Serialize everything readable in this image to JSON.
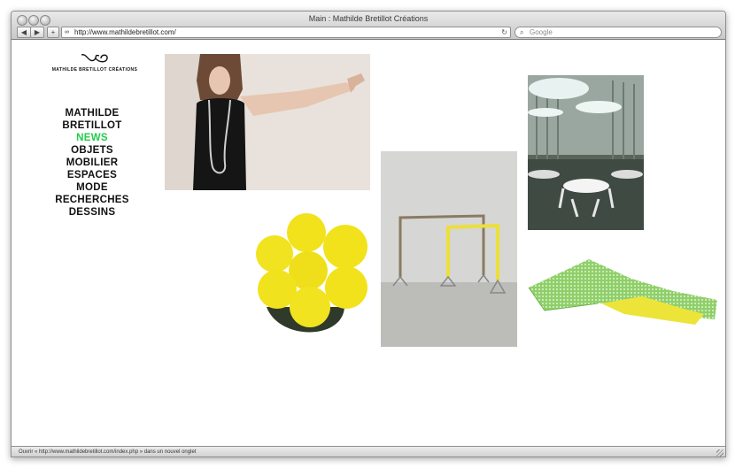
{
  "browser": {
    "window_title": "Main : Mathilde Bretillot Créations",
    "back_icon": "back-arrow-icon",
    "forward_icon": "forward-arrow-icon",
    "add_bookmark_label": "+",
    "url": "http://www.mathildebretillot.com/",
    "reload_icon": "reload-icon",
    "search_placeholder": "Google",
    "status_text": "Ouvrir « http://www.mathildebretillot.com/index.php » dans un nouvel onglet"
  },
  "site": {
    "logo_text": "MATHILDE BRETILLOT CRÉATIONS",
    "nav": [
      {
        "label": "MATHILDE BRETILLOT",
        "active": false
      },
      {
        "label": "NEWS",
        "active": true
      },
      {
        "label": "OBJETS",
        "active": false
      },
      {
        "label": "MOBILIER",
        "active": false
      },
      {
        "label": "ESPACES",
        "active": false
      },
      {
        "label": "MODE",
        "active": false
      },
      {
        "label": "RECHERCHES",
        "active": false
      },
      {
        "label": "DESSINS",
        "active": false
      }
    ],
    "accent_color": "#22cc44"
  }
}
